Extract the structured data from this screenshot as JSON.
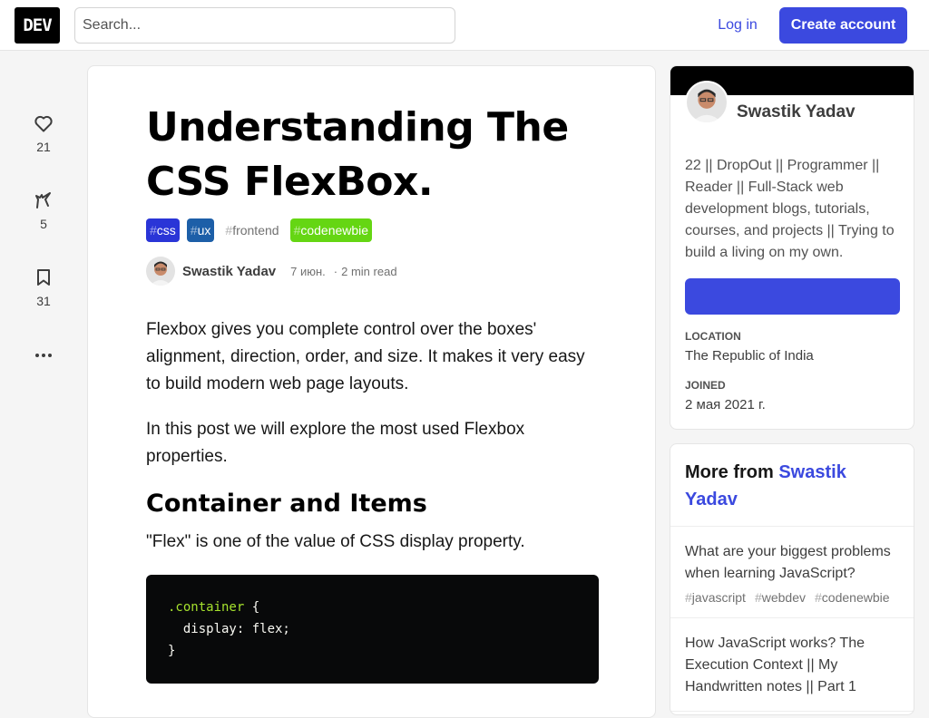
{
  "header": {
    "logo": "DEV",
    "search_placeholder": "Search...",
    "login_label": "Log in",
    "create_label": "Create account"
  },
  "reactions": {
    "likes": "21",
    "unicorns": "5",
    "bookmarks": "31"
  },
  "article": {
    "title": "Understanding The CSS FlexBox.",
    "tags": [
      {
        "name": "css",
        "bg": "#2a35d7",
        "fg": "#ffffff"
      },
      {
        "name": "ux",
        "bg": "#1d5fa8",
        "fg": "#ffffff"
      },
      {
        "name": "frontend",
        "bg": "#ffffff",
        "fg": "#717171"
      },
      {
        "name": "codenewbie",
        "bg": "#65d613",
        "fg": "#ffffff"
      }
    ],
    "author": "Swastik Yadav",
    "date": "7 июн.",
    "read_time": "2 min read",
    "p1": "Flexbox gives you complete control over the boxes' alignment, direction, order, and size. It makes it very easy to build modern web page layouts.",
    "p2": "In this post we will explore the most used Flexbox properties.",
    "h2": "Container and Items",
    "p3": "\"Flex\" is one of the value of CSS display property.",
    "code_line1_sel": ".container",
    "code_line1_rest": " {",
    "code_line2": "  display: flex;",
    "code_line3": "}"
  },
  "profile": {
    "name": "Swastik Yadav",
    "bio": "22 || DropOut || Programmer || Reader || Full-Stack web development blogs, tutorials, courses, and projects || Trying to build a living on my own.",
    "location_label": "LOCATION",
    "location": "The Republic of India",
    "joined_label": "JOINED",
    "joined": "2 мая 2021 г."
  },
  "more": {
    "heading_prefix": "More from ",
    "heading_link": "Swastik Yadav",
    "items": [
      {
        "title": "What are your biggest problems when learning JavaScript?",
        "tags": [
          "javascript",
          "webdev",
          "codenewbie"
        ]
      },
      {
        "title": "How JavaScript works? The Execution Context || My Handwritten notes || Part 1",
        "tags": []
      }
    ]
  },
  "colors": {
    "accent": "#3b49df",
    "code_bg": "#08090a"
  }
}
